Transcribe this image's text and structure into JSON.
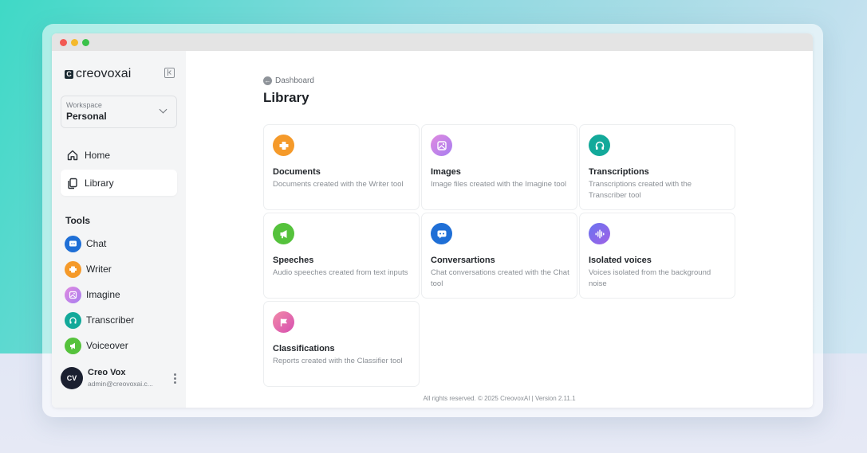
{
  "window": {
    "controls": [
      "close",
      "minimize",
      "maximize"
    ]
  },
  "sidebar": {
    "logo_mark": "C",
    "logo_text": "creovoxai",
    "workspace": {
      "label": "Workspace",
      "value": "Personal"
    },
    "nav": [
      {
        "label": "Home",
        "icon": "home-icon",
        "active": false
      },
      {
        "label": "Library",
        "icon": "library-icon",
        "active": true
      }
    ],
    "tools_title": "Tools",
    "tools": [
      {
        "label": "Chat",
        "icon": "chat-icon",
        "color": "#1f6fd6"
      },
      {
        "label": "Writer",
        "icon": "writer-icon",
        "color": "#f59a2a"
      },
      {
        "label": "Imagine",
        "icon": "imagine-icon",
        "color": "#c07ee6"
      },
      {
        "label": "Transcriber",
        "icon": "transcriber-icon",
        "color": "#13a99a"
      },
      {
        "label": "Voiceover",
        "icon": "voiceover-icon",
        "color": "#55c23c"
      }
    ],
    "user": {
      "initials": "CV",
      "name": "Creo Vox",
      "email": "admin@creovoxai.c..."
    }
  },
  "main": {
    "breadcrumb": "Dashboard",
    "title": "Library",
    "cards": [
      {
        "title": "Documents",
        "desc": "Documents created with the Writer tool",
        "icon": "documents-icon",
        "color": "#f59a2a"
      },
      {
        "title": "Images",
        "desc": "Image files created with the Imagine tool",
        "icon": "images-icon",
        "color": "#c07ee6"
      },
      {
        "title": "Transcriptions",
        "desc": "Transcriptions created with the Transcriber tool",
        "icon": "transcriptions-icon",
        "color": "#13a99a"
      },
      {
        "title": "Speeches",
        "desc": "Audio speeches created from text inputs",
        "icon": "speeches-icon",
        "color": "#55c23c"
      },
      {
        "title": "Conversartions",
        "desc": "Chat conversations created with the Chat tool",
        "icon": "conversations-icon",
        "color": "#1f6fd6"
      },
      {
        "title": "Isolated voices",
        "desc": "Voices isolated from the background noise",
        "icon": "isolated-voices-icon",
        "color": "#8a66e8"
      },
      {
        "title": "Classifications",
        "desc": "Reports created with the Classifier tool",
        "icon": "classifications-icon",
        "color": "#ec5fa0"
      }
    ],
    "footer": "All rights reserved. © 2025 CreovoxAI | Version 2.11.1"
  }
}
